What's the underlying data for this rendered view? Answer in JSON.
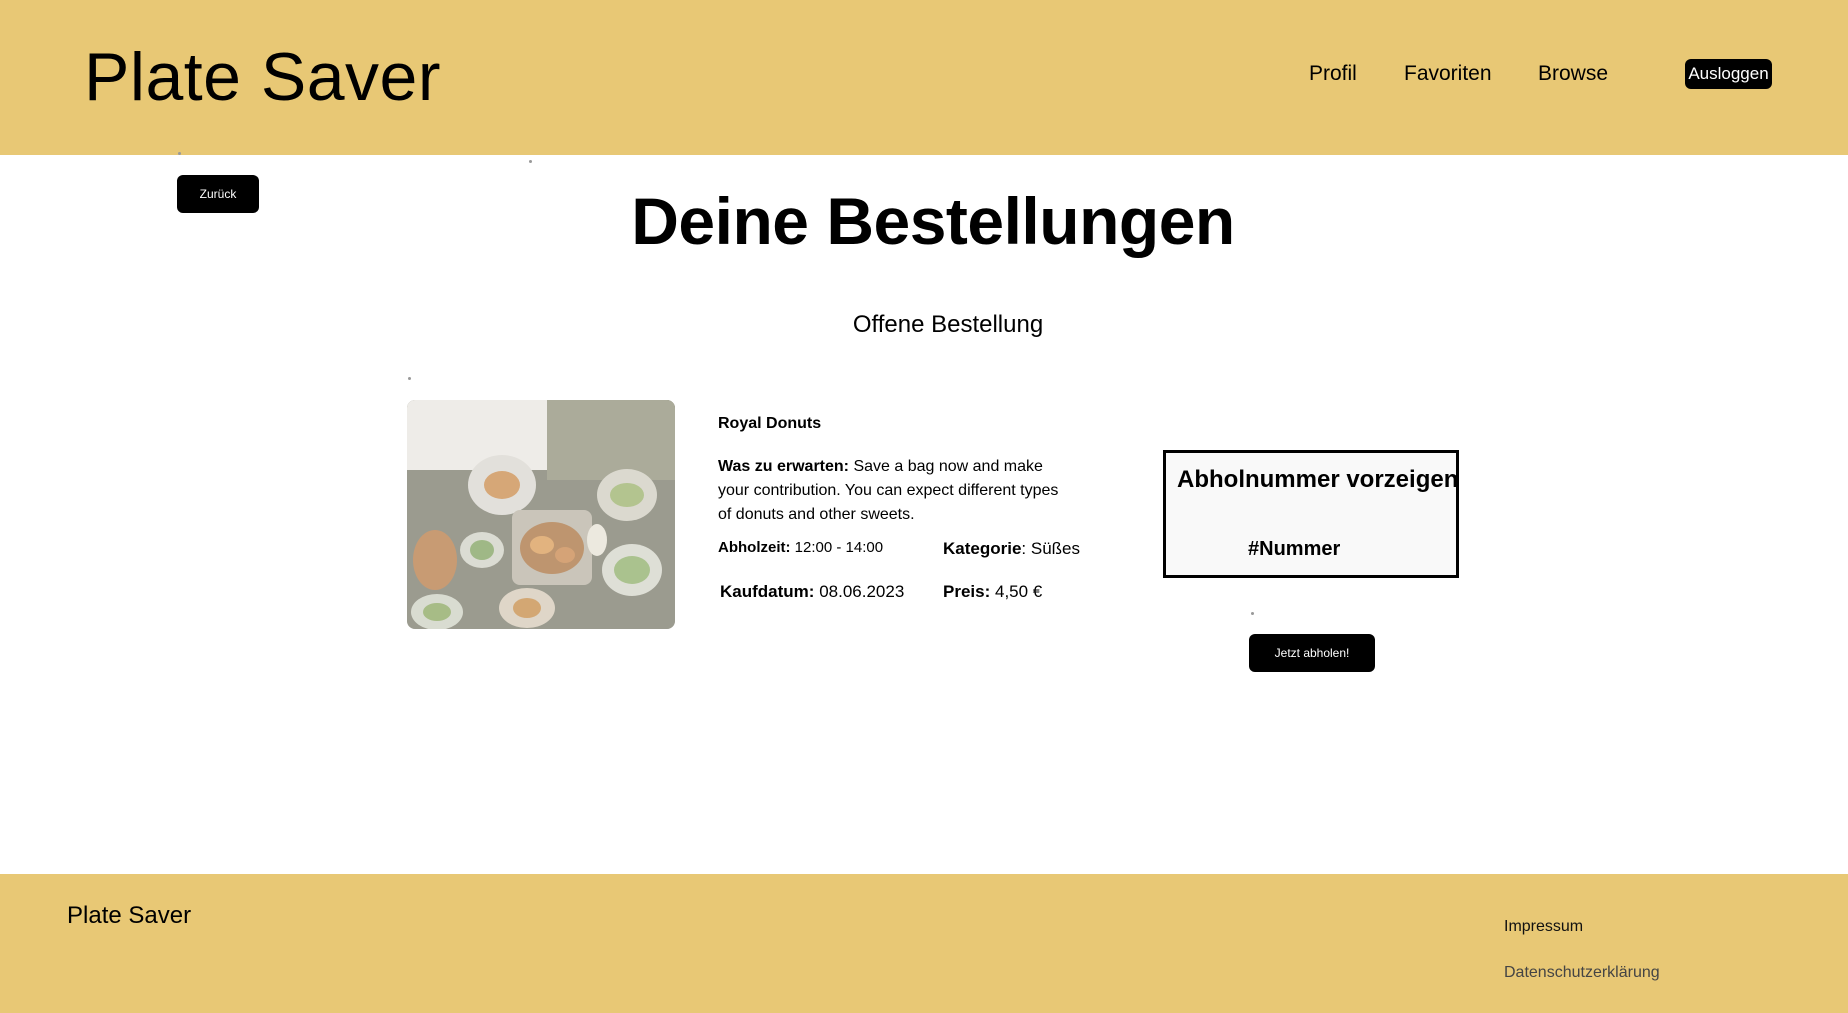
{
  "header": {
    "brand": "Plate Saver",
    "nav": [
      "Profil",
      "Favoriten",
      "Browse"
    ],
    "logout_label": "Ausloggen"
  },
  "back_label": "Zurück",
  "page_title": "Deine Bestellungen",
  "section_title": "Offene Bestellung",
  "order": {
    "shop_name": "Royal Donuts",
    "expect_label": "Was zu erwarten:",
    "expect_text": "Save a bag now and make your contribution. You can expect different types of donuts and other sweets.",
    "pickup_time_label": "Abholzeit:",
    "pickup_time": "12:00 - 14:00",
    "category_label": "Kategorie",
    "category": "Süßes",
    "purchase_date_label": "Kaufdatum:",
    "purchase_date": "08.06.2023",
    "price_label": "Preis:",
    "price": "4,50 €"
  },
  "pickup": {
    "title": "Abholnummer vorzeigen",
    "number": "#Nummer",
    "button_label": "Jetzt abholen!"
  },
  "footer": {
    "brand": "Plate Saver",
    "links": [
      "Impressum",
      "Datenschutzerklärung"
    ]
  },
  "colors": {
    "accent": "#e8c875",
    "button": "#000000"
  }
}
